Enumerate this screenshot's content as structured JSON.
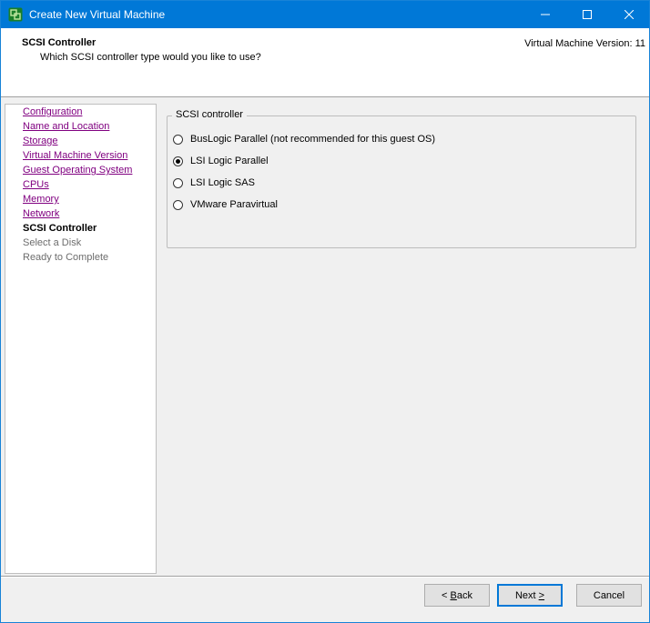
{
  "window": {
    "title": "Create New Virtual Machine",
    "accent_color": "#0078d7",
    "icon": "vsphere-logo-icon"
  },
  "header": {
    "title": "SCSI Controller",
    "subtitle": "Which SCSI controller type would you like to use?",
    "version_label": "Virtual Machine Version: 11"
  },
  "nav": {
    "items": [
      {
        "label": "Configuration",
        "state": "visited"
      },
      {
        "label": "Name and Location",
        "state": "visited"
      },
      {
        "label": "Storage",
        "state": "visited"
      },
      {
        "label": "Virtual Machine Version",
        "state": "visited"
      },
      {
        "label": "Guest Operating System",
        "state": "visited"
      },
      {
        "label": "CPUs",
        "state": "visited"
      },
      {
        "label": "Memory",
        "state": "visited"
      },
      {
        "label": "Network",
        "state": "visited"
      },
      {
        "label": "SCSI Controller",
        "state": "current"
      },
      {
        "label": "Select a Disk",
        "state": "pending"
      },
      {
        "label": "Ready to Complete",
        "state": "pending"
      }
    ]
  },
  "scsi": {
    "group_label": "SCSI controller",
    "options": [
      {
        "label": "BusLogic Parallel (not recommended for this guest OS)",
        "selected": false
      },
      {
        "label": "LSI Logic Parallel",
        "selected": true
      },
      {
        "label": "LSI Logic SAS",
        "selected": false
      },
      {
        "label": "VMware Paravirtual",
        "selected": false
      }
    ]
  },
  "buttons": {
    "back_mnemonic": "B",
    "back_rest": "ack",
    "back_prefix": "< ",
    "next_text": "Next ",
    "next_mnemonic": ">",
    "cancel": "Cancel"
  }
}
